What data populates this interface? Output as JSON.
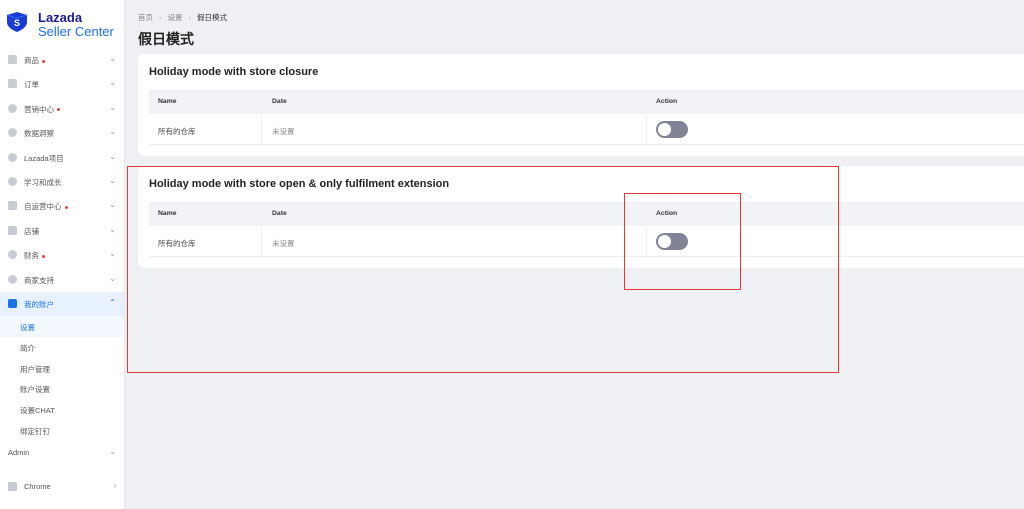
{
  "brand": {
    "line1": "Lazada",
    "line2": "Seller Center"
  },
  "sidebar": {
    "items": [
      {
        "label": "商品",
        "dot": true,
        "icon": "box-icon"
      },
      {
        "label": "订单",
        "dot": false,
        "icon": "order-icon"
      },
      {
        "label": "营销中心",
        "dot": true,
        "icon": "marketing-icon"
      },
      {
        "label": "数据洞察",
        "dot": false,
        "icon": "data-icon"
      },
      {
        "label": "Lazada项目",
        "dot": false,
        "icon": "shield-icon"
      },
      {
        "label": "学习和成长",
        "dot": false,
        "icon": "learn-icon"
      },
      {
        "label": "自运营中心",
        "dot": true,
        "icon": "operations-icon"
      },
      {
        "label": "店铺",
        "dot": false,
        "icon": "store-icon"
      },
      {
        "label": "财务",
        "dot": true,
        "icon": "finance-icon"
      },
      {
        "label": "商家支持",
        "dot": false,
        "icon": "support-icon"
      },
      {
        "label": "我的账户",
        "dot": false,
        "icon": "account-icon",
        "active": true
      }
    ],
    "sub_items": [
      {
        "label": "设置",
        "active": true
      },
      {
        "label": "简介"
      },
      {
        "label": "用户管理"
      },
      {
        "label": "账户设置"
      },
      {
        "label": "设置CHAT"
      },
      {
        "label": "绑定钉钉"
      }
    ],
    "admin_label": "Admin",
    "chrome_label": "Chrome"
  },
  "breadcrumb": {
    "items": [
      "首页",
      "设置"
    ],
    "current": "假日模式"
  },
  "page_title": "假日模式",
  "cards": [
    {
      "title": "Holiday mode with store closure",
      "columns": [
        "Name",
        "Date",
        "Action"
      ],
      "rows": [
        {
          "name": "所有的仓库",
          "date": "未设置",
          "toggle_on": false
        }
      ]
    },
    {
      "title": "Holiday mode with store open & only fulfilment extension",
      "columns": [
        "Name",
        "Date",
        "Action"
      ],
      "rows": [
        {
          "name": "所有的仓库",
          "date": "未设置",
          "toggle_on": false
        }
      ]
    }
  ],
  "colors": {
    "accent": "#1a72e8",
    "highlight_box": "#e53935",
    "toggle_off": "#7f8596"
  }
}
